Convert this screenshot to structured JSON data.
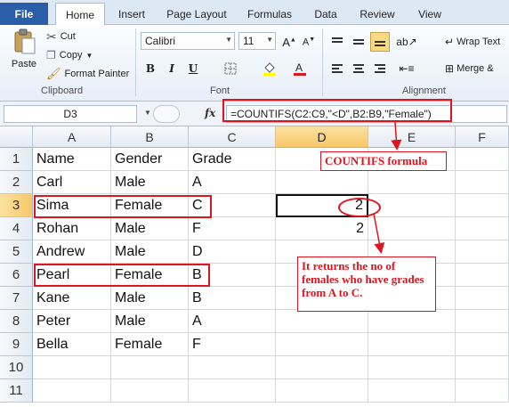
{
  "tabs": [
    "File",
    "Home",
    "Insert",
    "Page Layout",
    "Formulas",
    "Data",
    "Review",
    "View"
  ],
  "ribbon": {
    "clipboard": {
      "paste": "Paste",
      "cut": "Cut",
      "copy": "Copy",
      "format_painter": "Format Painter",
      "label": "Clipboard"
    },
    "font": {
      "name": "Calibri",
      "size": "11",
      "bold": "B",
      "italic": "I",
      "underline": "U",
      "label": "Font"
    },
    "alignment": {
      "wrap_text": "Wrap Text",
      "merge": "Merge &",
      "label": "Alignment"
    }
  },
  "formula_bar": {
    "name_box": "D3",
    "fx": "fx",
    "formula": "=COUNTIFS(C2:C9,\"<D\",B2:B9,\"Female\")"
  },
  "columns": [
    "A",
    "B",
    "C",
    "D",
    "E",
    "F"
  ],
  "rows": [
    {
      "num": "1",
      "a": "Name",
      "b": "Gender",
      "c": "Grade",
      "d": ""
    },
    {
      "num": "2",
      "a": "Carl",
      "b": "Male",
      "c": "A",
      "d": ""
    },
    {
      "num": "3",
      "a": "Sima",
      "b": "Female",
      "c": "C",
      "d": "2"
    },
    {
      "num": "4",
      "a": "Rohan",
      "b": "Male",
      "c": "F",
      "d": "2"
    },
    {
      "num": "5",
      "a": "Andrew",
      "b": "Male",
      "c": "D",
      "d": ""
    },
    {
      "num": "6",
      "a": "Pearl",
      "b": "Female",
      "c": "B",
      "d": ""
    },
    {
      "num": "7",
      "a": "Kane",
      "b": "Male",
      "c": "B",
      "d": ""
    },
    {
      "num": "8",
      "a": "Peter",
      "b": "Male",
      "c": "A",
      "d": ""
    },
    {
      "num": "9",
      "a": "Bella",
      "b": "Female",
      "c": "F",
      "d": ""
    },
    {
      "num": "10",
      "a": "",
      "b": "",
      "c": "",
      "d": ""
    },
    {
      "num": "11",
      "a": "",
      "b": "",
      "c": "",
      "d": ""
    }
  ],
  "annotations": {
    "formula_note": "COUNTIFS formula",
    "result_note": "It returns the no of females who have grades from A to C."
  },
  "colors": {
    "file_tab": "#2a5ea8",
    "annotation": "#e0141e",
    "selected_header": "#f7c766"
  }
}
